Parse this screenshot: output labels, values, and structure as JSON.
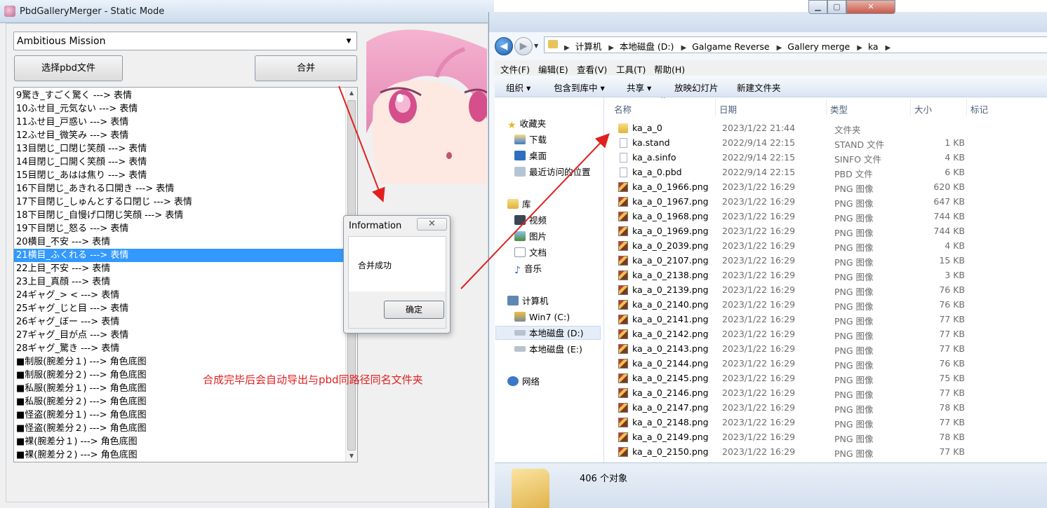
{
  "merger": {
    "title": "PbdGalleryMerger - Static Mode",
    "mission_value": "Ambitious Mission",
    "select_pbd_label": "选择pbd文件",
    "merge_label": "合并",
    "selected_index": 12,
    "expressions": [
      "9驚き_すごく驚く ---> 表情",
      "10ふせ目_元気ない ---> 表情",
      "11ふせ目_戸惑い ---> 表情",
      "12ふせ目_微笑み ---> 表情",
      "13目閉じ_口閉じ笑顔 ---> 表情",
      "14目閉じ_口開く笑顔 ---> 表情",
      "15目閉じ_あはは焦り ---> 表情",
      "16下目閉じ_あきれる口開き ---> 表情",
      "17下目閉じ_しゅんとする口閉じ ---> 表情",
      "18下目閉じ_自慢げ口閉じ笑顔 ---> 表情",
      "19下目閉じ_怒る ---> 表情",
      "20横目_不安 ---> 表情",
      "21横目_ふくれる ---> 表情",
      "22上目_不安 ---> 表情",
      "23上目_真顔 ---> 表情",
      "24ギャグ_> < ---> 表情",
      "25ギャグ_じと目 ---> 表情",
      "26ギャグ_ぼー ---> 表情",
      "27ギャグ_目が点 ---> 表情",
      "28ギャグ_驚き ---> 表情",
      "■制服(腕差分１) ---> 角色底图",
      "■制服(腕差分２) ---> 角色底图",
      "■私服(腕差分１) ---> 角色底图",
      "■私服(腕差分２) ---> 角色底图",
      "■怪盗(腕差分１) ---> 角色底图",
      "■怪盗(腕差分２) ---> 角色底图",
      "■裸(腕差分１) ---> 角色底图",
      "■裸(腕差分２) ---> 角色底图"
    ],
    "annotation": "合成完毕后会自动导出与pbd同路径同名文件夹"
  },
  "dialog": {
    "title": "Information",
    "close_glyph": "✕",
    "message": "合并成功",
    "ok_label": "确定"
  },
  "explorer": {
    "breadcrumbs": [
      "计算机",
      "本地磁盘 (D:)",
      "Galgame Reverse",
      "Gallery merge",
      "ka"
    ],
    "menu": [
      "文件(F)",
      "编辑(E)",
      "查看(V)",
      "工具(T)",
      "帮助(H)"
    ],
    "toolbar": [
      "组织 ▾",
      "包含到库中 ▾",
      "共享 ▾",
      "放映幻灯片",
      "新建文件夹"
    ],
    "nav": {
      "favorites": "收藏夹",
      "downloads": "下载",
      "desktop": "桌面",
      "recent": "最近访问的位置",
      "libraries": "库",
      "videos": "视频",
      "pictures": "图片",
      "documents": "文档",
      "music": "音乐",
      "computer": "计算机",
      "drive_c": "Win7 (C:)",
      "drive_d": "本地磁盘 (D:)",
      "drive_e": "本地磁盘 (E:)",
      "network": "网络"
    },
    "columns": {
      "name": "名称",
      "date": "日期",
      "type": "类型",
      "size": "大小",
      "tags": "标记"
    },
    "files": [
      {
        "name": "ka_a_0",
        "date": "2023/1/22 21:44",
        "type": "文件夹",
        "size": "",
        "icon": "folder"
      },
      {
        "name": "ka.stand",
        "date": "2022/9/14 22:15",
        "type": "STAND 文件",
        "size": "1 KB",
        "icon": "file"
      },
      {
        "name": "ka_a.sinfo",
        "date": "2022/9/14 22:15",
        "type": "SINFO 文件",
        "size": "4 KB",
        "icon": "file"
      },
      {
        "name": "ka_a_0.pbd",
        "date": "2022/9/14 22:15",
        "type": "PBD 文件",
        "size": "6 KB",
        "icon": "file"
      },
      {
        "name": "ka_a_0_1966.png",
        "date": "2023/1/22 16:29",
        "type": "PNG 图像",
        "size": "620 KB",
        "icon": "png"
      },
      {
        "name": "ka_a_0_1967.png",
        "date": "2023/1/22 16:29",
        "type": "PNG 图像",
        "size": "647 KB",
        "icon": "png"
      },
      {
        "name": "ka_a_0_1968.png",
        "date": "2023/1/22 16:29",
        "type": "PNG 图像",
        "size": "744 KB",
        "icon": "png"
      },
      {
        "name": "ka_a_0_1969.png",
        "date": "2023/1/22 16:29",
        "type": "PNG 图像",
        "size": "744 KB",
        "icon": "png"
      },
      {
        "name": "ka_a_0_2039.png",
        "date": "2023/1/22 16:29",
        "type": "PNG 图像",
        "size": "4 KB",
        "icon": "png"
      },
      {
        "name": "ka_a_0_2107.png",
        "date": "2023/1/22 16:29",
        "type": "PNG 图像",
        "size": "15 KB",
        "icon": "png"
      },
      {
        "name": "ka_a_0_2138.png",
        "date": "2023/1/22 16:29",
        "type": "PNG 图像",
        "size": "3 KB",
        "icon": "png"
      },
      {
        "name": "ka_a_0_2139.png",
        "date": "2023/1/22 16:29",
        "type": "PNG 图像",
        "size": "76 KB",
        "icon": "png"
      },
      {
        "name": "ka_a_0_2140.png",
        "date": "2023/1/22 16:29",
        "type": "PNG 图像",
        "size": "76 KB",
        "icon": "png"
      },
      {
        "name": "ka_a_0_2141.png",
        "date": "2023/1/22 16:29",
        "type": "PNG 图像",
        "size": "77 KB",
        "icon": "png"
      },
      {
        "name": "ka_a_0_2142.png",
        "date": "2023/1/22 16:29",
        "type": "PNG 图像",
        "size": "77 KB",
        "icon": "png"
      },
      {
        "name": "ka_a_0_2143.png",
        "date": "2023/1/22 16:29",
        "type": "PNG 图像",
        "size": "77 KB",
        "icon": "png"
      },
      {
        "name": "ka_a_0_2144.png",
        "date": "2023/1/22 16:29",
        "type": "PNG 图像",
        "size": "76 KB",
        "icon": "png"
      },
      {
        "name": "ka_a_0_2145.png",
        "date": "2023/1/22 16:29",
        "type": "PNG 图像",
        "size": "75 KB",
        "icon": "png"
      },
      {
        "name": "ka_a_0_2146.png",
        "date": "2023/1/22 16:29",
        "type": "PNG 图像",
        "size": "77 KB",
        "icon": "png"
      },
      {
        "name": "ka_a_0_2147.png",
        "date": "2023/1/22 16:29",
        "type": "PNG 图像",
        "size": "78 KB",
        "icon": "png"
      },
      {
        "name": "ka_a_0_2148.png",
        "date": "2023/1/22 16:29",
        "type": "PNG 图像",
        "size": "77 KB",
        "icon": "png"
      },
      {
        "name": "ka_a_0_2149.png",
        "date": "2023/1/22 16:29",
        "type": "PNG 图像",
        "size": "78 KB",
        "icon": "png"
      },
      {
        "name": "ka_a_0_2150.png",
        "date": "2023/1/22 16:29",
        "type": "PNG 图像",
        "size": "77 KB",
        "icon": "png"
      }
    ],
    "status_count": "406 个对象"
  },
  "colors": {
    "selection": "#3399ff",
    "annotation": "#e02020"
  }
}
